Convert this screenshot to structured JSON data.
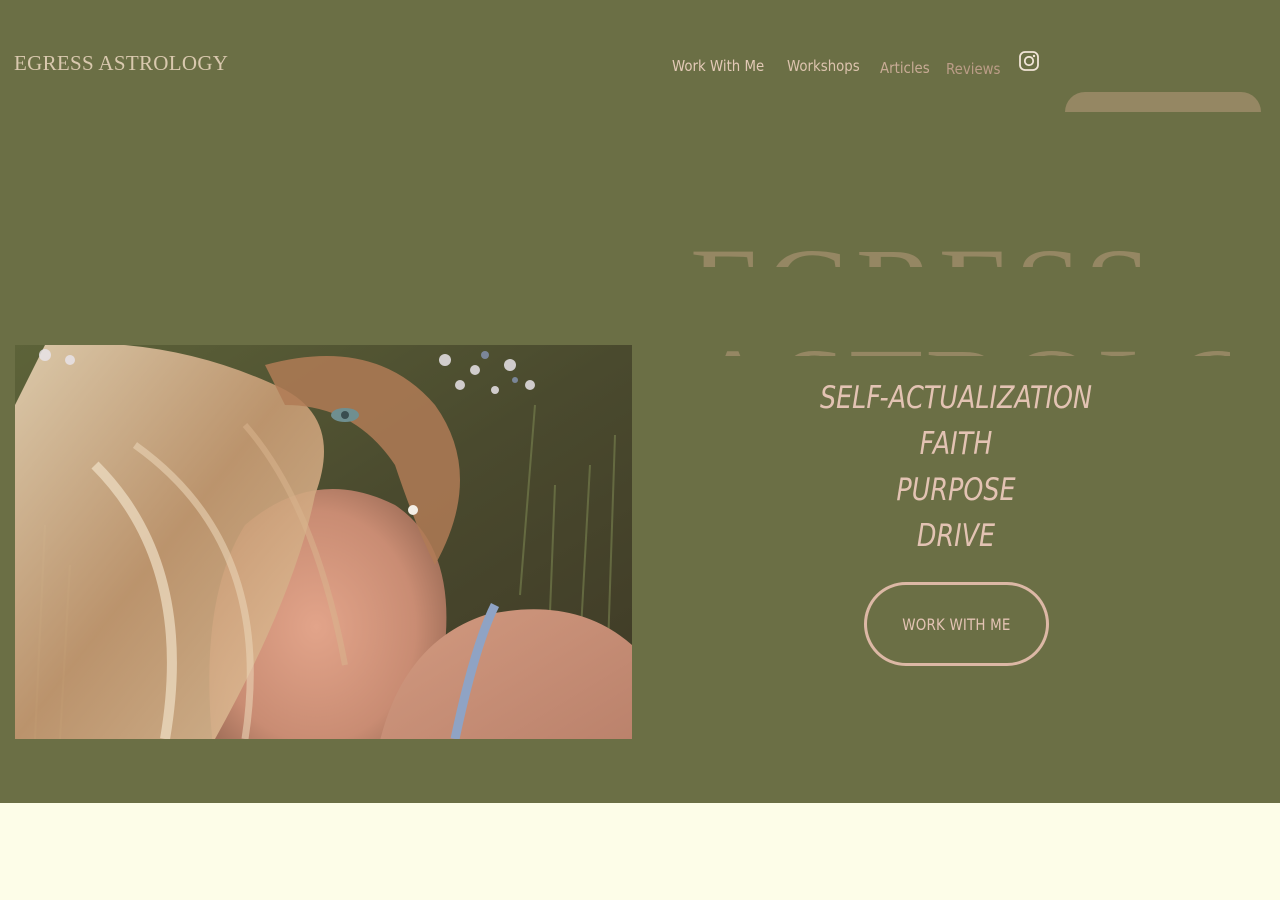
{
  "header": {
    "logo_text": "EGRESS ASTROLOGY",
    "nav": [
      {
        "label": "Work With Me"
      },
      {
        "label": "Workshops"
      },
      {
        "label": "Articles"
      },
      {
        "label": "Reviews"
      }
    ],
    "social_icon": "instagram-icon"
  },
  "hero": {
    "title_line1": "EGRESS",
    "title_line2": "ASTROLOGY",
    "tagline": [
      "SELF-ACTUALIZATION",
      "FAITH",
      "PURPOSE",
      "DRIVE"
    ],
    "cta_label": "WORK WITH ME"
  },
  "colors": {
    "hero_background": "#6b6f45",
    "accent_tan": "#958763",
    "text_pink": "#e3c3b3",
    "page_background": "#fdfde8"
  }
}
